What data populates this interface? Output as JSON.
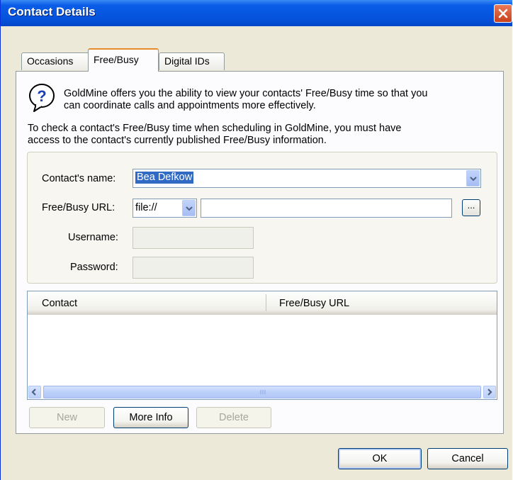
{
  "window": {
    "title": "Contact Details",
    "close_icon": "close-icon"
  },
  "tabs": [
    {
      "label": "Occasions",
      "active": false
    },
    {
      "label": "Free/Busy",
      "active": true
    },
    {
      "label": "Digital IDs",
      "active": false
    }
  ],
  "info": {
    "icon": "question-bubble-icon",
    "line1": "GoldMine offers you the ability to view your contacts' Free/Busy time so that you",
    "line2": "can coordinate calls and appointments more effectively.",
    "line3": "To check a contact's Free/Busy time when scheduling in GoldMine, you must have",
    "line4": "access to the contact's currently published Free/Busy information."
  },
  "form": {
    "contact_name_label": "Contact's name:",
    "contact_name_value": "Bea Defkow",
    "url_label": "Free/Busy URL:",
    "protocol_value": "file://",
    "url_value": "",
    "browse_label": "...",
    "username_label": "Username:",
    "username_value": "",
    "password_label": "Password:",
    "password_value": ""
  },
  "list": {
    "columns": [
      "Contact",
      "Free/Busy URL"
    ],
    "rows": [],
    "scroll_left_icon": "chevron-left-icon",
    "scroll_right_icon": "chevron-right-icon"
  },
  "actions": {
    "new_label": "New",
    "more_info_label": "More Info",
    "delete_label": "Delete"
  },
  "footer": {
    "ok_label": "OK",
    "cancel_label": "Cancel"
  },
  "colors": {
    "titlebar": "#0553dd",
    "selection": "#316ac5",
    "active_tab_accent": "#e68b2c",
    "dialog_bg": "#ece9d8"
  }
}
